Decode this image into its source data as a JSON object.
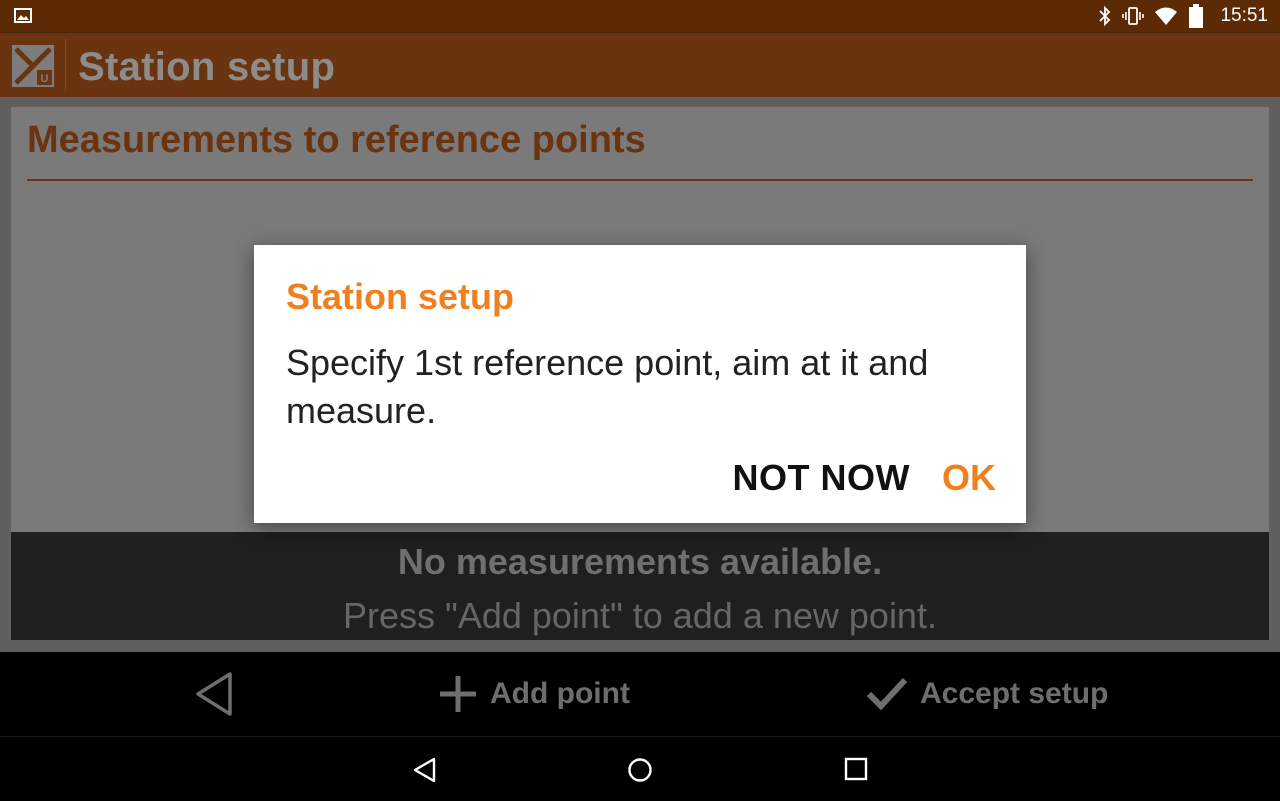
{
  "status_bar": {
    "time": "15:51",
    "left_icon": "image-notification-icon",
    "right_icons": [
      "bluetooth-icon",
      "vibrate-icon",
      "wifi-icon",
      "battery-icon"
    ]
  },
  "app_bar": {
    "title": "Station setup",
    "logo_icon": "app-logo-icon"
  },
  "section": {
    "title": "Measurements to reference points"
  },
  "empty_state": {
    "title": "No measurements available.",
    "subtitle": "Press \"Add point\" to add a new point."
  },
  "action_bar": {
    "back_icon": "back-triangle-icon",
    "add_point_label": "Add point",
    "add_point_icon": "plus-icon",
    "accept_setup_label": "Accept setup",
    "accept_setup_icon": "checkmark-icon"
  },
  "dialog": {
    "title": "Station setup",
    "message": "Specify 1st reference point, aim at it and measure.",
    "negative_button": "NOT NOW",
    "positive_button": "OK"
  },
  "nav_bar": {
    "icons": [
      "nav-back-icon",
      "nav-home-icon",
      "nav-recents-icon"
    ]
  },
  "colors": {
    "accent": "#f07f1e",
    "app_bar": "#6b3410",
    "status_bar": "#5c2a05"
  }
}
